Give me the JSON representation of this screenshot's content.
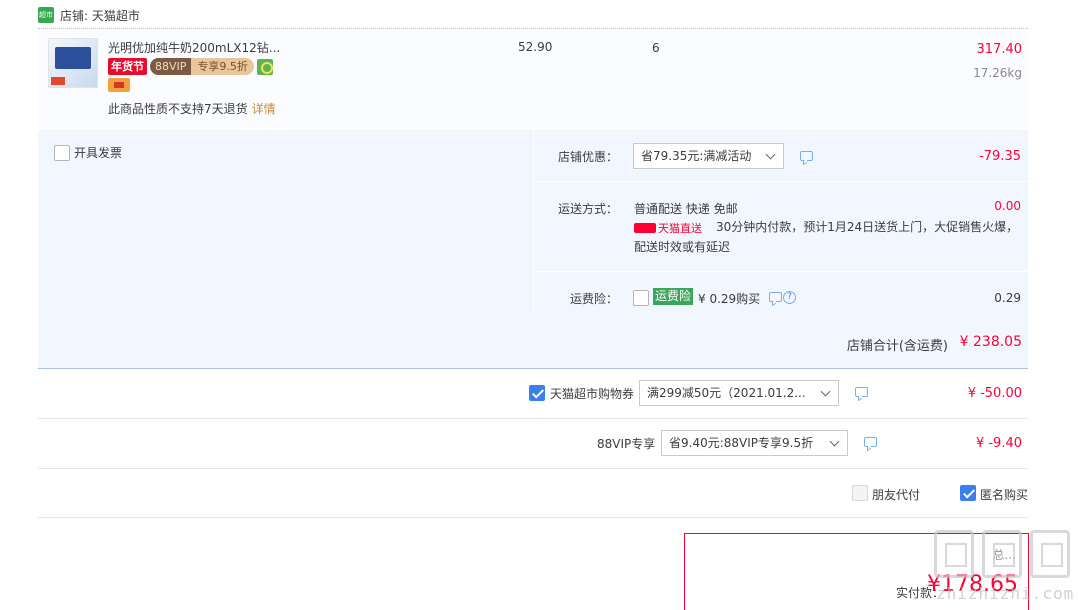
{
  "shop": {
    "label": "店铺: 天猫超市",
    "logo_text": "超市",
    "logo_color": "#36a852"
  },
  "item": {
    "title": "光明优加纯牛奶200mLX12钻...",
    "badge_festival": "年货节",
    "badge_vip": "88VIP",
    "badge_vip_discount": "专享9.5折",
    "no_return_text": "此商品性质不支持7天退货",
    "no_return_link": "详情",
    "unit_price": "52.90",
    "quantity": "6",
    "subtotal": "317.40",
    "weight": "17.26kg"
  },
  "invoice": {
    "label": "开具发票",
    "checked": false
  },
  "shop_discount": {
    "label": "店铺优惠：",
    "selected": "省79.35元:满减活动",
    "amount": "-79.35"
  },
  "shipping": {
    "label": "运送方式：",
    "method": "普通配送 快递 免邮",
    "cost": "0.00",
    "brand": "天猫直送",
    "description": "30分钟内付款，预计1月24日送货上门，大促销售火爆，配送时效或有延迟"
  },
  "insurance": {
    "label": "运费险：",
    "tag": "运费险",
    "price_text": "¥ 0.29购买",
    "amount": "0.29",
    "help": "?"
  },
  "shop_total": {
    "label": "店铺合计(含运费)",
    "value": "¥ 238.05"
  },
  "coupon": {
    "label": "天猫超市购物券",
    "checked": true,
    "selected": "满299减50元（2021.01.2...",
    "amount": "¥ -50.00"
  },
  "vip": {
    "label": "88VIP专享",
    "selected": "省9.40元:88VIP专享9.5折",
    "amount": "¥ -9.40"
  },
  "options": {
    "friend_pay": "朋友代付",
    "friend_pay_checked": false,
    "anonymous": "匿名购买",
    "anonymous_checked": true
  },
  "payment": {
    "total_label": "总...",
    "paid_label": "实付款：",
    "paid_value": "¥178.65"
  },
  "watermark": {
    "text": "zhizhizhi.com"
  },
  "colors": {
    "accent_red": "#ff0036",
    "blue_check": "#3a7ff0",
    "panel_bg": "#f2f7ff"
  }
}
